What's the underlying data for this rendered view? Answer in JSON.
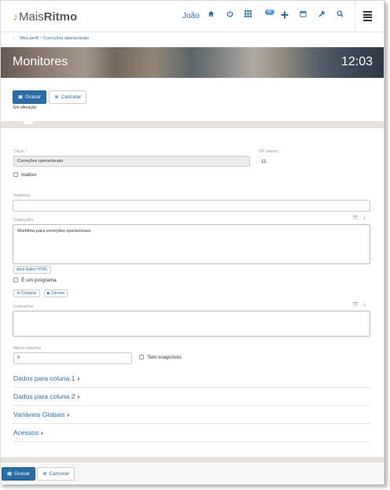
{
  "nav": {
    "logo_prefix": "Mais",
    "logo_suffix": "Ritmo",
    "user": "João",
    "notification_count": "42",
    "icons": [
      "home-icon",
      "power-icon",
      "apps-grid-icon",
      "plus-icon",
      "calendar-icon",
      "wrench-icon",
      "search-icon",
      "menu-icon"
    ]
  },
  "breadcrumb": {
    "items": [
      "Meu perfil",
      "Correções operacionais"
    ]
  },
  "banner": {
    "title": "Monitores",
    "clock": "12:03"
  },
  "actions": {
    "save": "Gravar",
    "cancel": "Cancelar",
    "status": "Em alteração"
  },
  "form": {
    "title_label": "Título *",
    "title_value": "Correções operacionais",
    "internal_no_label": "Nº interno",
    "internal_no_value": "11",
    "inactive_label": "Inativo",
    "subtitle_label": "Subtítulo",
    "subtitle_value": "",
    "header_label": "Cabeçalho",
    "header_value": "Workflow para correções operacionais",
    "html_editor": "Abrir Editor HTML",
    "is_program_label": "É um programa",
    "compile": "Compilar",
    "simulate": "Simular",
    "instructions_label": "Instruções",
    "instructions_value": "",
    "max_height_label": "Altura máxima",
    "max_height_value": "0",
    "snapshots_label": "Tem snapshots"
  },
  "sections": [
    {
      "label": "Dados para coluna 1"
    },
    {
      "label": "Dados para coluna 2"
    },
    {
      "label": "Variáveis Globais"
    },
    {
      "label": "Acessos"
    }
  ],
  "footer": {
    "save": "Gravar",
    "cancel": "Cancelar"
  },
  "colors": {
    "accent": "#2a6da6",
    "logo_note": "#e58a2a"
  }
}
